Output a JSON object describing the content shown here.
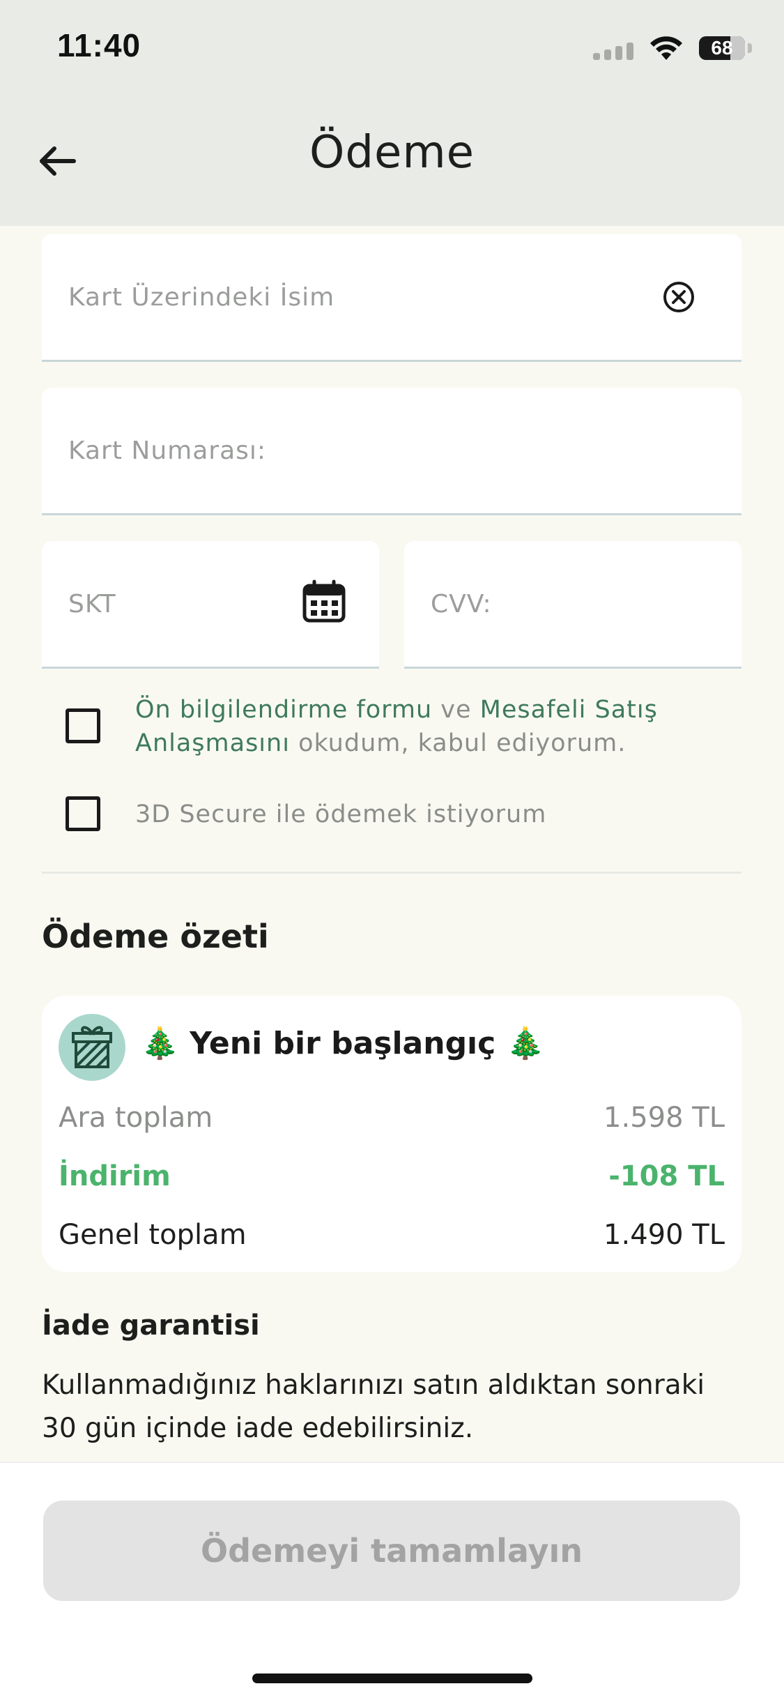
{
  "status_bar": {
    "time": "11:40",
    "battery": "68"
  },
  "header": {
    "title": "Ödeme",
    "back_icon": "arrow-left-icon"
  },
  "form": {
    "card_name_placeholder": "Kart Üzerindeki İsim",
    "card_number_placeholder": "Kart Numarası:",
    "expiry_placeholder": "SKT",
    "cvv_placeholder": "CVV:",
    "clear_icon": "clear-circle-icon",
    "calendar_icon": "calendar-icon"
  },
  "agreements": {
    "preinfo_link": "Ön bilgilendirme formu",
    "and_text": " ve ",
    "distance_sales_link": "Mesafeli Satış Anlaşmasını",
    "accept_text": " okudum, kabul ediyorum.",
    "secure_text": "3D Secure ile ödemek istiyorum",
    "preinfo_checked": false,
    "secure_checked": false
  },
  "summary": {
    "title": "Ödeme özeti",
    "campaign": "🎄 Yeni bir başlangıç 🎄",
    "gift_icon": "gift-icon",
    "subtotal_label": "Ara toplam",
    "subtotal_value": "1.598 TL",
    "discount_label": "İndirim",
    "discount_value": "-108 TL",
    "total_label": "Genel toplam",
    "total_value": "1.490 TL",
    "colors": {
      "discount": "#4bb36c",
      "link": "#3f7a5a"
    }
  },
  "refund": {
    "title": "İade garantisi",
    "text": "Kullanmadığınız haklarınızı satın aldıktan sonraki 30 gün içinde iade edebilirsiniz."
  },
  "footer": {
    "pay_button": "Ödemeyi tamamlayın"
  }
}
